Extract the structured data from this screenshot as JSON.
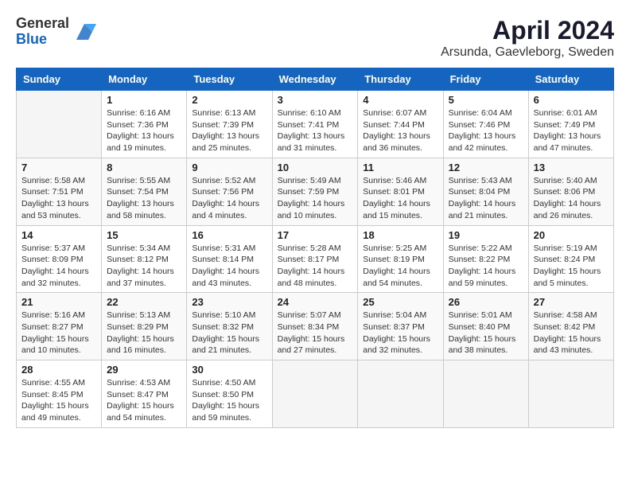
{
  "logo": {
    "general": "General",
    "blue": "Blue"
  },
  "title": {
    "month_year": "April 2024",
    "location": "Arsunda, Gaevleborg, Sweden"
  },
  "headers": [
    "Sunday",
    "Monday",
    "Tuesday",
    "Wednesday",
    "Thursday",
    "Friday",
    "Saturday"
  ],
  "weeks": [
    [
      {
        "day": "",
        "info": ""
      },
      {
        "day": "1",
        "info": "Sunrise: 6:16 AM\nSunset: 7:36 PM\nDaylight: 13 hours\nand 19 minutes."
      },
      {
        "day": "2",
        "info": "Sunrise: 6:13 AM\nSunset: 7:39 PM\nDaylight: 13 hours\nand 25 minutes."
      },
      {
        "day": "3",
        "info": "Sunrise: 6:10 AM\nSunset: 7:41 PM\nDaylight: 13 hours\nand 31 minutes."
      },
      {
        "day": "4",
        "info": "Sunrise: 6:07 AM\nSunset: 7:44 PM\nDaylight: 13 hours\nand 36 minutes."
      },
      {
        "day": "5",
        "info": "Sunrise: 6:04 AM\nSunset: 7:46 PM\nDaylight: 13 hours\nand 42 minutes."
      },
      {
        "day": "6",
        "info": "Sunrise: 6:01 AM\nSunset: 7:49 PM\nDaylight: 13 hours\nand 47 minutes."
      }
    ],
    [
      {
        "day": "7",
        "info": "Sunrise: 5:58 AM\nSunset: 7:51 PM\nDaylight: 13 hours\nand 53 minutes."
      },
      {
        "day": "8",
        "info": "Sunrise: 5:55 AM\nSunset: 7:54 PM\nDaylight: 13 hours\nand 58 minutes."
      },
      {
        "day": "9",
        "info": "Sunrise: 5:52 AM\nSunset: 7:56 PM\nDaylight: 14 hours\nand 4 minutes."
      },
      {
        "day": "10",
        "info": "Sunrise: 5:49 AM\nSunset: 7:59 PM\nDaylight: 14 hours\nand 10 minutes."
      },
      {
        "day": "11",
        "info": "Sunrise: 5:46 AM\nSunset: 8:01 PM\nDaylight: 14 hours\nand 15 minutes."
      },
      {
        "day": "12",
        "info": "Sunrise: 5:43 AM\nSunset: 8:04 PM\nDaylight: 14 hours\nand 21 minutes."
      },
      {
        "day": "13",
        "info": "Sunrise: 5:40 AM\nSunset: 8:06 PM\nDaylight: 14 hours\nand 26 minutes."
      }
    ],
    [
      {
        "day": "14",
        "info": "Sunrise: 5:37 AM\nSunset: 8:09 PM\nDaylight: 14 hours\nand 32 minutes."
      },
      {
        "day": "15",
        "info": "Sunrise: 5:34 AM\nSunset: 8:12 PM\nDaylight: 14 hours\nand 37 minutes."
      },
      {
        "day": "16",
        "info": "Sunrise: 5:31 AM\nSunset: 8:14 PM\nDaylight: 14 hours\nand 43 minutes."
      },
      {
        "day": "17",
        "info": "Sunrise: 5:28 AM\nSunset: 8:17 PM\nDaylight: 14 hours\nand 48 minutes."
      },
      {
        "day": "18",
        "info": "Sunrise: 5:25 AM\nSunset: 8:19 PM\nDaylight: 14 hours\nand 54 minutes."
      },
      {
        "day": "19",
        "info": "Sunrise: 5:22 AM\nSunset: 8:22 PM\nDaylight: 14 hours\nand 59 minutes."
      },
      {
        "day": "20",
        "info": "Sunrise: 5:19 AM\nSunset: 8:24 PM\nDaylight: 15 hours\nand 5 minutes."
      }
    ],
    [
      {
        "day": "21",
        "info": "Sunrise: 5:16 AM\nSunset: 8:27 PM\nDaylight: 15 hours\nand 10 minutes."
      },
      {
        "day": "22",
        "info": "Sunrise: 5:13 AM\nSunset: 8:29 PM\nDaylight: 15 hours\nand 16 minutes."
      },
      {
        "day": "23",
        "info": "Sunrise: 5:10 AM\nSunset: 8:32 PM\nDaylight: 15 hours\nand 21 minutes."
      },
      {
        "day": "24",
        "info": "Sunrise: 5:07 AM\nSunset: 8:34 PM\nDaylight: 15 hours\nand 27 minutes."
      },
      {
        "day": "25",
        "info": "Sunrise: 5:04 AM\nSunset: 8:37 PM\nDaylight: 15 hours\nand 32 minutes."
      },
      {
        "day": "26",
        "info": "Sunrise: 5:01 AM\nSunset: 8:40 PM\nDaylight: 15 hours\nand 38 minutes."
      },
      {
        "day": "27",
        "info": "Sunrise: 4:58 AM\nSunset: 8:42 PM\nDaylight: 15 hours\nand 43 minutes."
      }
    ],
    [
      {
        "day": "28",
        "info": "Sunrise: 4:55 AM\nSunset: 8:45 PM\nDaylight: 15 hours\nand 49 minutes."
      },
      {
        "day": "29",
        "info": "Sunrise: 4:53 AM\nSunset: 8:47 PM\nDaylight: 15 hours\nand 54 minutes."
      },
      {
        "day": "30",
        "info": "Sunrise: 4:50 AM\nSunset: 8:50 PM\nDaylight: 15 hours\nand 59 minutes."
      },
      {
        "day": "",
        "info": ""
      },
      {
        "day": "",
        "info": ""
      },
      {
        "day": "",
        "info": ""
      },
      {
        "day": "",
        "info": ""
      }
    ]
  ]
}
